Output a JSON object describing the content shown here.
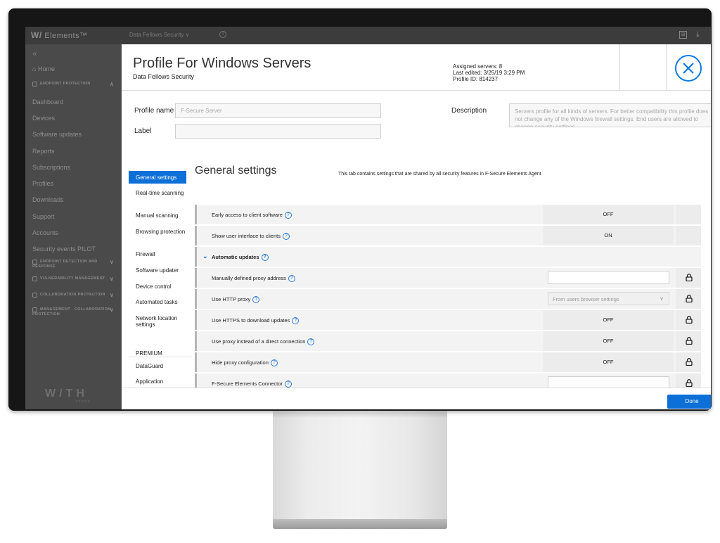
{
  "topbar": {
    "brand_mark": "W/",
    "brand_name": "Elements™",
    "organization": "Data Fellows Security ∨",
    "info_glyph": "i",
    "grid_glyph": "⊞",
    "download_glyph": "⤓"
  },
  "sidebar": {
    "collapse_glyph": "«",
    "home_glyph": "⌂",
    "home": "Home",
    "groups": [
      {
        "label": "ENDPOINT PROTECTION",
        "chev": "∧"
      },
      {
        "label": "ENDPOINT DETECTION AND RESPONSE",
        "chev": "∨"
      },
      {
        "label": "VULNERABILITY MANAGEMENT",
        "chev": "∨"
      },
      {
        "label": "COLLABORATION PROTECTION",
        "chev": "∨"
      },
      {
        "label": "MANAGEMENT - COLLABORATION PROTECTION",
        "chev": "∨"
      }
    ],
    "items": [
      "Dashboard",
      "Devices",
      "Software updates",
      "Reports",
      "Subscriptions",
      "Profiles",
      "Downloads",
      "Support",
      "Accounts",
      "Security events PILOT"
    ],
    "logo": "W/TH",
    "logo_sub": "secure"
  },
  "modal": {
    "title": "Profile For Windows Servers",
    "subtitle": "Data Fellows Security",
    "assigned_servers": "Assigned servers: 8",
    "last_edited": "Last edited: 3/25/19 3:29 PM",
    "profile_id": "Profile ID: 814237",
    "profile_name_label": "Profile name",
    "profile_name_value": "F-Secure Server",
    "label_label": "Label",
    "label_value": "",
    "description_label": "Description",
    "description_value": "Servers profile for all kinds of servers. For better compatibility this profile does not change any of the Windows firewall settings. End users are allowed to change security settings.",
    "done": "Done"
  },
  "tabs": [
    "General settings",
    "Real-time scanning",
    "Manual scanning",
    "Browsing protection",
    "Firewall",
    "Software updater",
    "Device control",
    "Automated tasks",
    "Network location settings"
  ],
  "premium_label": "PREMIUM",
  "premium_tabs": [
    "DataGuard",
    "Application"
  ],
  "section": {
    "title": "General settings",
    "description": "This tab contains settings that are shared by all security features in F-Secure Elements Agent"
  },
  "help_glyph": "?",
  "expand_glyph": "⌄",
  "select_arrow_glyph": "∨",
  "settings": [
    {
      "label": "Early access to client software",
      "value": "OFF"
    },
    {
      "label": "Show user interface to clients",
      "value": "ON"
    },
    {
      "label": "Automatic updates"
    },
    {
      "label": "Manually defined proxy address",
      "value": ""
    },
    {
      "label": "Use HTTP proxy",
      "value": "From users browser settings"
    },
    {
      "label": "Use HTTPS to download updates",
      "value": "OFF"
    },
    {
      "label": "Use proxy instead of a direct connection",
      "value": "OFF"
    },
    {
      "label": "Hide proxy configuration",
      "value": "OFF"
    },
    {
      "label": "F-Secure Elements Connector",
      "value": ""
    }
  ]
}
